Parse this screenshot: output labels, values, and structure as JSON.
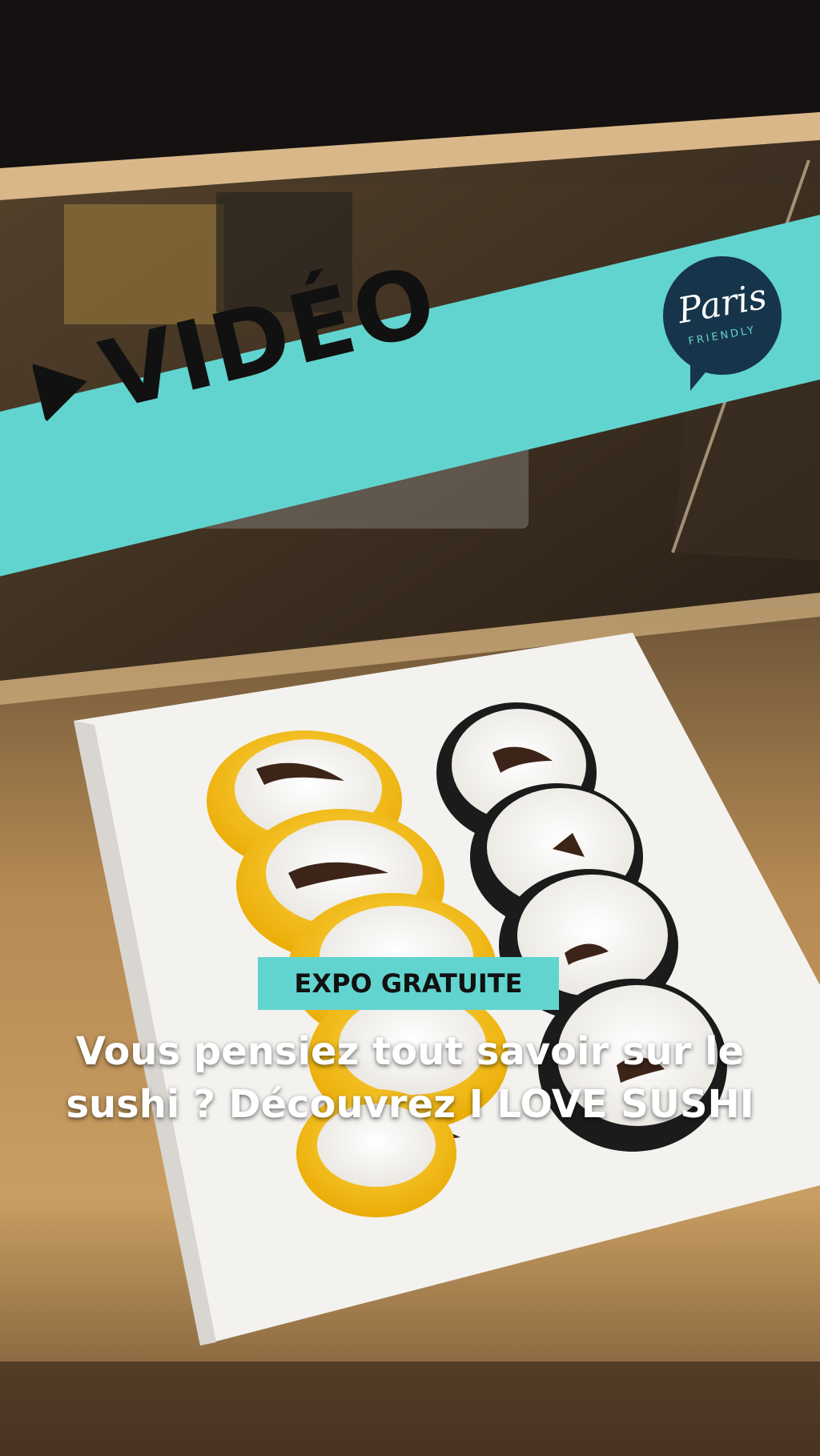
{
  "banner": {
    "label": "VIDÉO",
    "color": "#62d4cf"
  },
  "logo": {
    "main": "Paris",
    "sub": "FRIENDLY",
    "color": "#17354a"
  },
  "tag": {
    "label": "EXPO GRATUITE"
  },
  "headline": {
    "line1": "Vous pensiez tout savoir sur le",
    "line2": "sushi ? Découvrez I LOVE SUSHI"
  },
  "icons": {
    "play": "play-icon"
  }
}
